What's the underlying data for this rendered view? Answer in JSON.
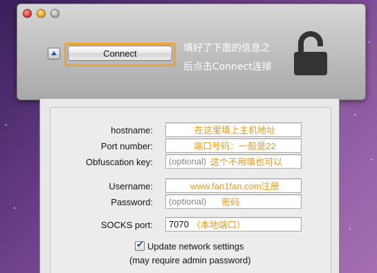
{
  "toolbar": {
    "connect_label": "Connect",
    "hint_line1": "填好了下面的信息之",
    "hint_line2": "后点击Connect连接"
  },
  "icons": {
    "window_close": "close-icon",
    "window_minimize": "minimize-icon",
    "window_zoom": "zoom-icon",
    "disclosure": "triangle-up-icon",
    "lock": "unlocked-padlock-icon"
  },
  "form": {
    "hostname": {
      "label": "hostname:",
      "annotation": "在这里填上主机地址"
    },
    "port": {
      "label": "Port number:",
      "annotation": "端口号码：一般是22"
    },
    "obfuscation": {
      "label": "Obfuscation key:",
      "placeholder": "(optional)",
      "annotation": "这个不用填也可以"
    },
    "username": {
      "label": "Username:",
      "annotation": "www.fan1fan.com注册"
    },
    "password": {
      "label": "Password:",
      "placeholder": "(optional)",
      "annotation": "密码"
    },
    "socks": {
      "label": "SOCKS port:",
      "value": "7070",
      "annotation": "（本地端口）"
    },
    "update_network": {
      "label": "Update network settings",
      "checked": true,
      "note": "(may require admin password)"
    }
  },
  "colors": {
    "annotation": "#e89a1a",
    "highlight_border": "#f0a030",
    "hint_text": "#ffffff"
  }
}
